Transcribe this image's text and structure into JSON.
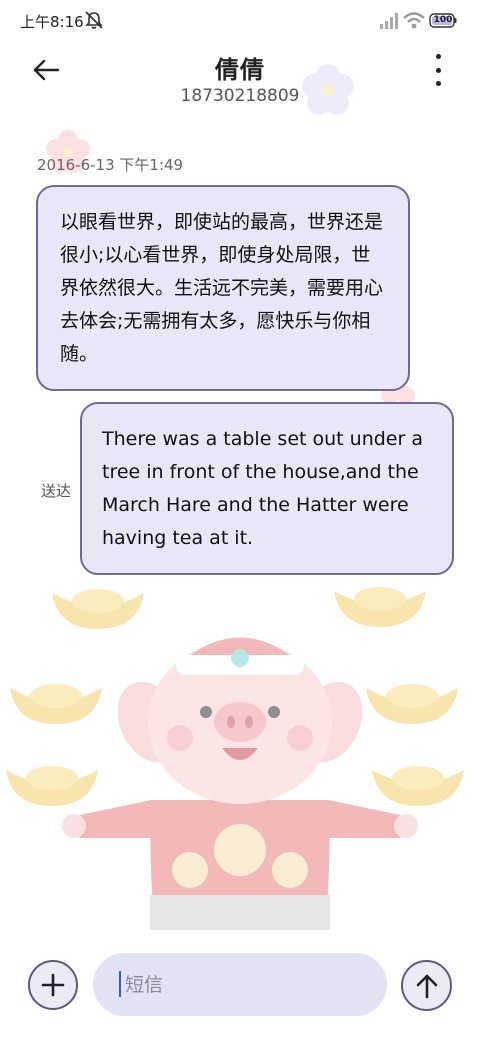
{
  "status_bar": {
    "time": "上午8:16",
    "battery": "100"
  },
  "header": {
    "contact_name": "倩倩",
    "contact_number": "18730218809"
  },
  "conversation": {
    "timestamp": "2016-6-13 下午1:49",
    "messages": [
      {
        "direction": "incoming",
        "text": "以眼看世界，即使站的最高，世界还是很小;以心看世界，即使身处局限，世界依然很大。生活远不完美，需要用心去体会;无需拥有太多，愿快乐与你相随。"
      },
      {
        "direction": "outgoing",
        "text": "There was a table set out under a tree in front of the house,and the March Hare and the Hatter were having tea at it.",
        "status": "送达"
      }
    ]
  },
  "composer": {
    "placeholder": "短信",
    "value": ""
  },
  "icons": {
    "back": "back-arrow-icon",
    "more": "more-vertical-icon",
    "add": "plus-icon",
    "send": "send-arrow-up-icon",
    "mute": "bell-muted-icon",
    "signal": "signal-icon",
    "wifi": "wifi-icon",
    "battery": "battery-icon"
  },
  "colors": {
    "bubble_fill": "#e8e6f6",
    "bubble_border": "#6e6a92",
    "input_fill": "#e3e2f2",
    "cursor": "#2f5ed8"
  }
}
